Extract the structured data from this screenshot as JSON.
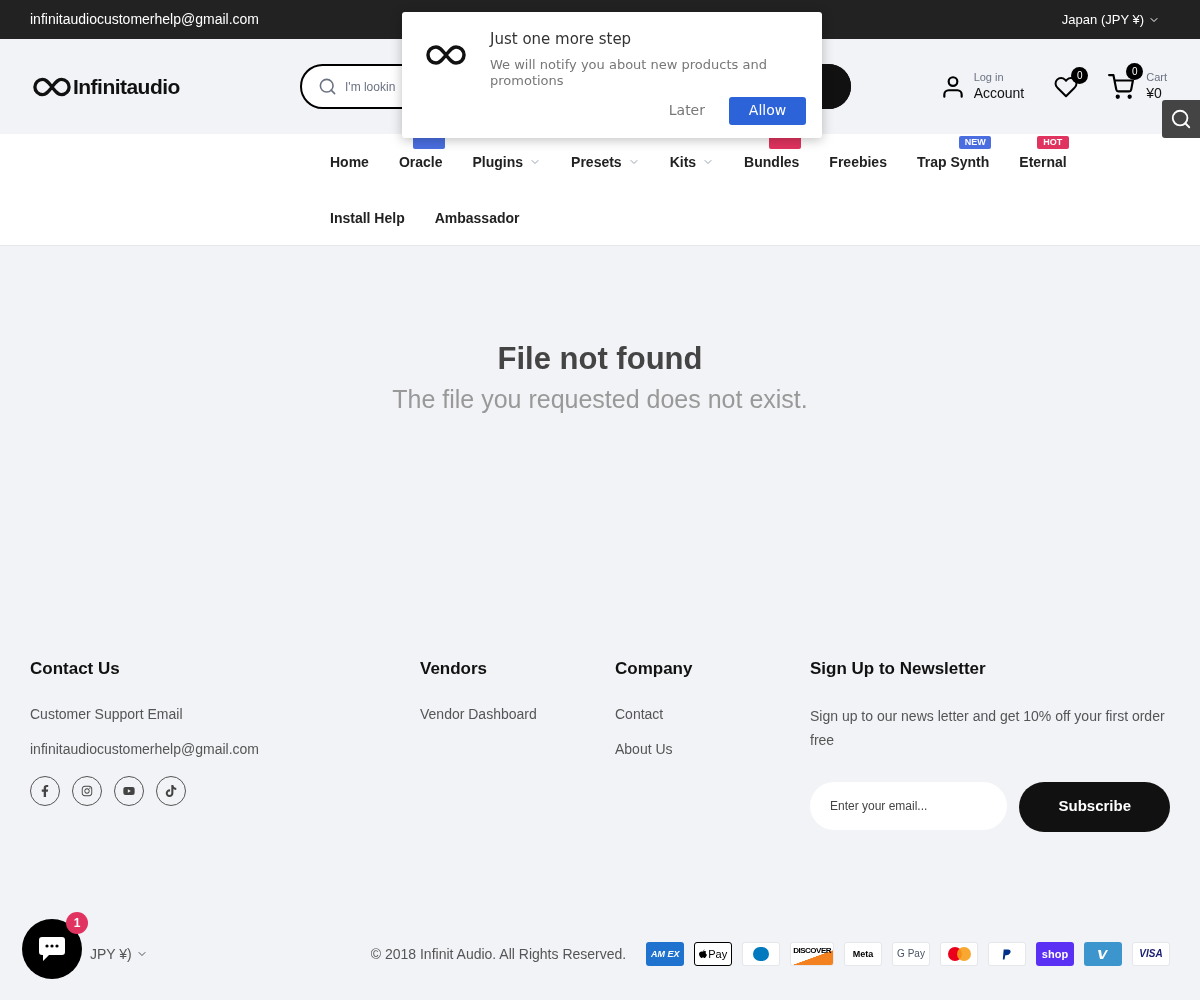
{
  "top_bar": {
    "email": "infinitaudiocustomerhelp@gmail.com",
    "currency": "Japan (JPY ¥)"
  },
  "header": {
    "logo": "Infinitaudio",
    "search": {
      "placeholder": "I'm lookin"
    },
    "account": {
      "small": "Log in",
      "label": "Account"
    },
    "wishlist_count": "0",
    "cart": {
      "count": "0",
      "small": "Cart",
      "total": "¥0"
    }
  },
  "nav": [
    {
      "label": "Home",
      "dropdown": false
    },
    {
      "label": "Oracle",
      "dropdown": false,
      "badge": {
        "color": "#4a6ee0"
      }
    },
    {
      "label": "Plugins",
      "dropdown": true
    },
    {
      "label": "Presets",
      "dropdown": true
    },
    {
      "label": "Kits",
      "dropdown": true
    },
    {
      "label": "Bundles",
      "dropdown": false,
      "badge": {
        "color": "#e0335f"
      }
    },
    {
      "label": "Freebies",
      "dropdown": false
    },
    {
      "label": "Trap Synth",
      "dropdown": false,
      "badge": {
        "text": "NEW",
        "color": "#4a6ee0"
      }
    },
    {
      "label": "Eternal",
      "dropdown": false,
      "badge": {
        "text": "HOT",
        "color": "#e0335f"
      }
    },
    {
      "label": "Install Help",
      "dropdown": false
    },
    {
      "label": "Ambassador",
      "dropdown": false
    }
  ],
  "main": {
    "title": "File not found",
    "message": "The file you requested does not exist."
  },
  "footer": {
    "columns": [
      {
        "heading": "Contact Us",
        "links": [
          "Customer Support Email",
          "infinitaudiocustomerhelp@gmail.com"
        ]
      },
      {
        "heading": "Vendors",
        "links": [
          "Vendor Dashboard"
        ]
      },
      {
        "heading": "Company",
        "links": [
          "Contact",
          "About Us"
        ]
      }
    ],
    "newsletter": {
      "heading": "Sign Up to Newsletter",
      "text": "Sign up to our news letter and get 10% off your first order free",
      "placeholder": "Enter your email...",
      "button": "Subscribe"
    },
    "currency": "JPY ¥)",
    "copyright": "© 2018 Infinit Audio. All Rights Reserved.",
    "payments": [
      {
        "kind": "amex",
        "label": "AM EX"
      },
      {
        "kind": "applepay",
        "label": "Pay"
      },
      {
        "kind": "diners"
      },
      {
        "kind": "discover",
        "label": "DISCOVER"
      },
      {
        "kind": "meta",
        "label": "Meta"
      },
      {
        "kind": "gpay",
        "label": "G Pay"
      },
      {
        "kind": "mastercard"
      },
      {
        "kind": "paypal"
      },
      {
        "kind": "shop",
        "label": "shop"
      },
      {
        "kind": "venmo"
      },
      {
        "kind": "visa",
        "label": "VISA"
      }
    ]
  },
  "chat": {
    "unread": "1"
  },
  "popup": {
    "title": "Just one more step",
    "message": "We will notify you about new products and promotions",
    "buttons": [
      "Later",
      "Allow"
    ]
  }
}
